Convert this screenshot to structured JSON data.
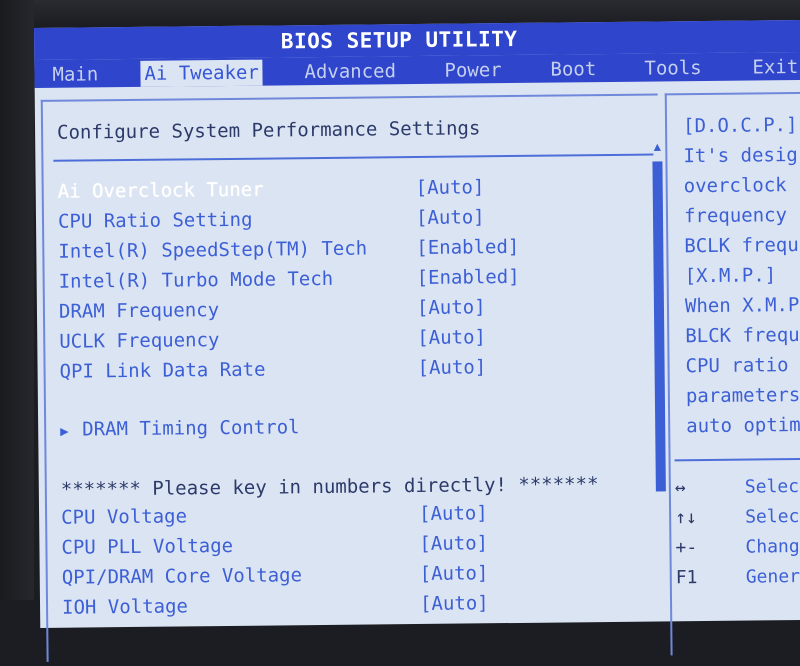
{
  "title": "BIOS SETUP UTILITY",
  "tabs": [
    {
      "label": "Main",
      "active": false
    },
    {
      "label": "Ai Tweaker",
      "active": true
    },
    {
      "label": "Advanced",
      "active": false
    },
    {
      "label": "Power",
      "active": false
    },
    {
      "label": "Boot",
      "active": false
    },
    {
      "label": "Tools",
      "active": false
    },
    {
      "label": "Exit",
      "active": false
    }
  ],
  "section_title": "Configure System Performance Settings",
  "settings": [
    {
      "label": "Ai Overclock Tuner",
      "value": "[Auto]",
      "selected": true
    },
    {
      "label": "CPU Ratio Setting",
      "value": "[Auto]"
    },
    {
      "label": "Intel(R) SpeedStep(TM) Tech",
      "value": "[Enabled]"
    },
    {
      "label": "Intel(R) Turbo Mode Tech",
      "value": "[Enabled]"
    },
    {
      "label": "DRAM Frequency",
      "value": "[Auto]"
    },
    {
      "label": "UCLK Frequency",
      "value": "[Auto]"
    },
    {
      "label": "QPI Link Data Rate",
      "value": "[Auto]"
    }
  ],
  "submenu": {
    "label": "DRAM Timing Control",
    "icon": "triangle-right-icon"
  },
  "note": "******* Please key in numbers directly! *******",
  "voltages": [
    {
      "label": "CPU Voltage",
      "value": "[Auto]"
    },
    {
      "label": "CPU PLL Voltage",
      "value": "[Auto]"
    },
    {
      "label": "QPI/DRAM Core Voltage",
      "value": "[Auto]"
    },
    {
      "label": "IOH Voltage",
      "value": "[Auto]"
    }
  ],
  "help_text": [
    "[D.O.C.P.]",
    "It's desig",
    "overclock",
    "frequency",
    "BCLK frequ",
    "[X.M.P.]",
    "When X.M.P",
    "BLCK frequ",
    "CPU ratio",
    "parameters",
    "auto optim"
  ],
  "key_help": [
    {
      "key": "↔",
      "desc": "Selec"
    },
    {
      "key": "↑↓",
      "desc": "Selec"
    },
    {
      "key": "+-",
      "desc": "Chang"
    },
    {
      "key": "F1",
      "desc": "Gener"
    }
  ]
}
